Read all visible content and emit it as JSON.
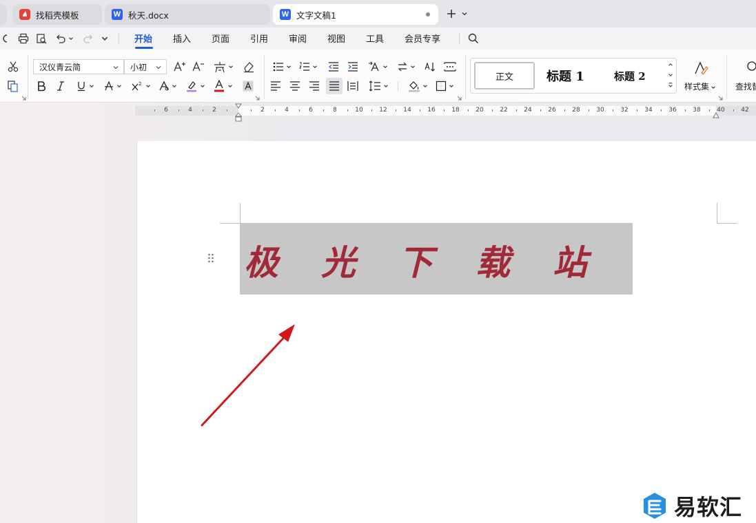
{
  "tabs": [
    {
      "label": "找稻壳模板",
      "icon": "docer-icon"
    },
    {
      "label": "秋天.docx",
      "icon": "word-icon"
    },
    {
      "label": "文字文稿1",
      "icon": "word-icon"
    }
  ],
  "word_icon_letter": "W",
  "menu": {
    "items": [
      "开始",
      "插入",
      "页面",
      "引用",
      "审阅",
      "视图",
      "工具",
      "会员专享"
    ],
    "active": "开始"
  },
  "ribbon": {
    "font_name": "汉仪青云简",
    "font_size": "小初",
    "styles": {
      "body": "正文",
      "h1": "标题 1",
      "h2": "标题 2"
    },
    "style_set_label": "样式集",
    "find_label": "查找替"
  },
  "ruler": {
    "left_numbers": [
      "6",
      "4",
      "2"
    ],
    "right_numbers": [
      "2",
      "4",
      "6",
      "8",
      "10",
      "12",
      "14",
      "16",
      "18",
      "20",
      "22",
      "24",
      "26",
      "28",
      "30",
      "32",
      "34",
      "36",
      "38",
      "40",
      "42"
    ]
  },
  "document": {
    "heading_chars": [
      "极",
      "光",
      "下",
      "载",
      "站"
    ]
  },
  "colors": {
    "accent": "#1f5fd6",
    "heading_text": "#a12a38",
    "arrow": "#d41818"
  },
  "watermark": {
    "text": "易软汇"
  }
}
